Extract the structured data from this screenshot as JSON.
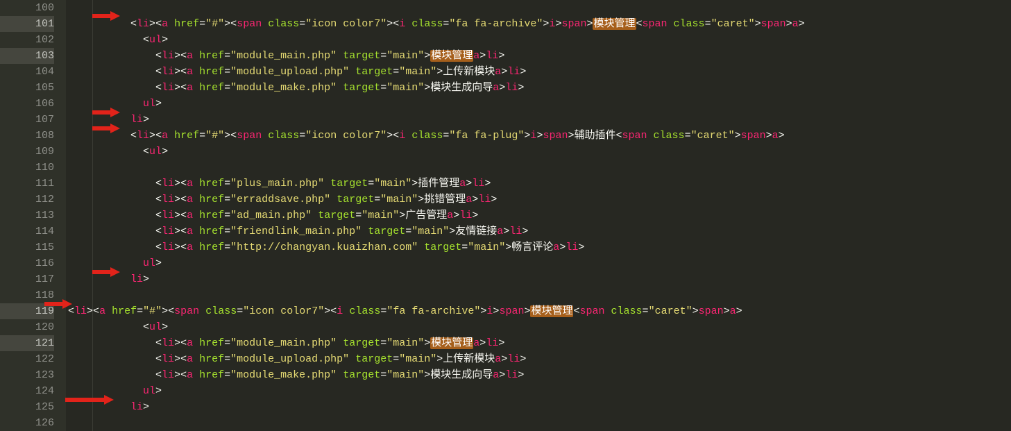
{
  "gutter": {
    "start": 100,
    "end": 126,
    "marked": [
      101,
      103,
      119,
      121
    ]
  },
  "tokens": {
    "lt": "<",
    "gt": ">",
    "lts": "</",
    "eq": "=",
    "q": "\"",
    "li": "li",
    "a": "a",
    "ul": "ul",
    "span": "span",
    "i": "i",
    "href": "href",
    "class": "class",
    "target": "target"
  },
  "strings": {
    "hash": "#",
    "main": "main",
    "iconcolor7": "icon color7",
    "faarchive": "fa fa-archive",
    "faplug": "fa fa-plug",
    "caret": "caret",
    "module_main": "module_main.php",
    "module_upload": "module_upload.php",
    "module_make": "module_make.php",
    "plus_main": "plus_main.php",
    "erraddsave": "erraddsave.php",
    "ad_main": "ad_main.php",
    "friendlink_main": "friendlink_main.php",
    "changyan": "http://changyan.kuaizhan.com"
  },
  "text": {
    "mokuaiguanli": "模块管理",
    "shangchuanxin": "上传新模块",
    "mokuaisheng": "模块生成向导",
    "fuzhuchajian": "辅助插件",
    "chajianguanli": "插件管理",
    "tiaocuoguanli": "挑错管理",
    "guanggaoguanli": "广告管理",
    "youqinglianjie": "友情链接",
    "changyanpinglun": "畅言评论"
  },
  "indent": {
    "i0": "",
    "i10": "          ",
    "i12": "            ",
    "i14": "              "
  }
}
